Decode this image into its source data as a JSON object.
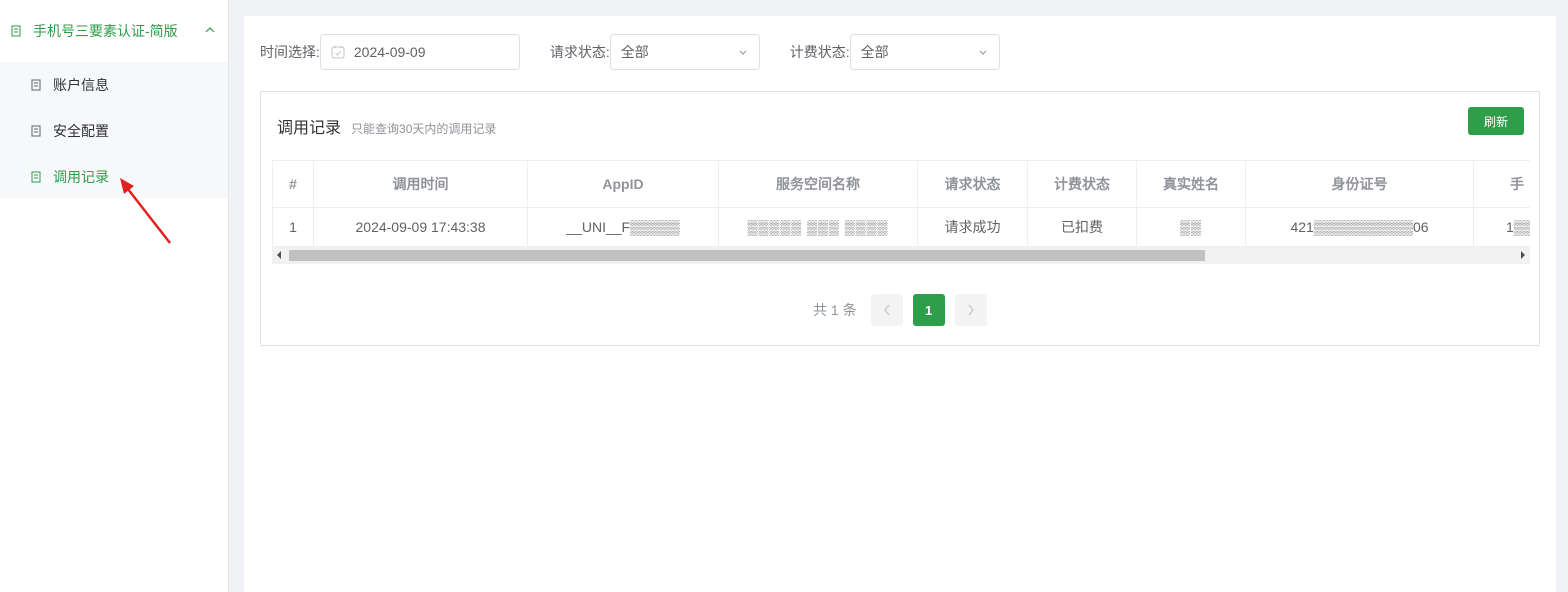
{
  "sidebar": {
    "menu_title": "手机号三要素认证-简版",
    "items": [
      {
        "label": "账户信息"
      },
      {
        "label": "安全配置"
      },
      {
        "label": "调用记录"
      }
    ]
  },
  "filters": {
    "date_label": "时间选择:",
    "date_value": "2024-09-09",
    "request_label": "请求状态:",
    "request_value": "全部",
    "billing_label": "计费状态:",
    "billing_value": "全部"
  },
  "panel": {
    "title": "调用记录",
    "subtitle": "只能查询30天内的调用记录",
    "refresh_label": "刷新"
  },
  "table": {
    "headers": [
      "#",
      "调用时间",
      "AppID",
      "服务空间名称",
      "请求状态",
      "计费状态",
      "真实姓名",
      "身份证号",
      "手"
    ],
    "rows": [
      [
        "1",
        "2024-09-09 17:43:38",
        "__UNI__F▒▒▒▒▒",
        "▒▒▒▒▒ ▒▒▒ ▒▒▒▒",
        "请求成功",
        "已扣费",
        "▒▒",
        "421▒▒▒▒▒▒▒▒▒▒06",
        "1▒▒"
      ]
    ]
  },
  "pagination": {
    "total_text": "共 1 条",
    "current_page": "1"
  },
  "colors": {
    "accent": "#2e9e4a"
  }
}
